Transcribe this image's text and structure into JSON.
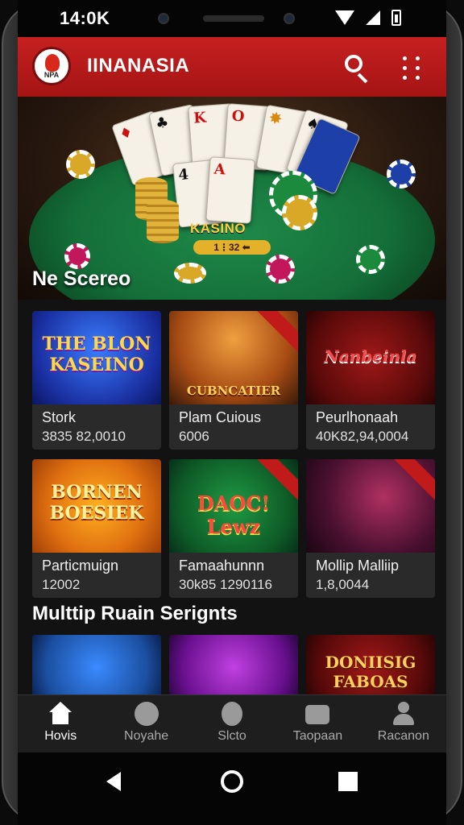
{
  "status": {
    "time": "14:0K"
  },
  "appbar": {
    "title": "IINANASIA",
    "logo_text": "NPA"
  },
  "hero": {
    "title": "Ne Scereo",
    "brand": "KASINO",
    "pill": "1⋮32  ⬅",
    "cards": [
      "K",
      "O",
      "4",
      "A"
    ]
  },
  "games": [
    {
      "art": "THE BLON KASEINO",
      "name": "Stork",
      "count": "3835 82,0010",
      "art_color": "#1a4fd8"
    },
    {
      "art": "CUBNCATIER",
      "name": "Plam Cuious",
      "count": "6006",
      "art_color": "#c46a1c",
      "ribbon": true
    },
    {
      "art": "Nanbeinla",
      "name": "Peurlhonaah",
      "count": "40K82,94,0004",
      "art_color": "#7a1010"
    },
    {
      "art": "BORNEN BOESIEK",
      "name": "Particmuign",
      "count": "12002",
      "art_color": "#e08a10"
    },
    {
      "art": "DAOC! Lewz",
      "name": "Famaahunnn",
      "count": "30k85 1290116",
      "art_color": "#0e6b2a",
      "ribbon": true
    },
    {
      "art": "",
      "name": "Mollip Malliip",
      "count": "1,8,0044",
      "art_color": "#3a1230",
      "ribbon": true
    }
  ],
  "section2": {
    "title": "Multtip Ruain Serignts"
  },
  "games2": [
    {
      "art": "",
      "art_color": "#1b5fb0"
    },
    {
      "art": "",
      "art_color": "#7a1fa0"
    },
    {
      "art": "DONIISIG FABOAS",
      "art_color": "#5a0a0a"
    }
  ],
  "nav": [
    {
      "label": "Hovis",
      "icon": "home-icon",
      "active": true
    },
    {
      "label": "Noyahe",
      "icon": "games-icon",
      "active": false
    },
    {
      "label": "Slcto",
      "icon": "slots-icon",
      "active": false
    },
    {
      "label": "Taopaan",
      "icon": "camera-icon",
      "active": false
    },
    {
      "label": "Racanon",
      "icon": "user-icon",
      "active": false
    }
  ]
}
